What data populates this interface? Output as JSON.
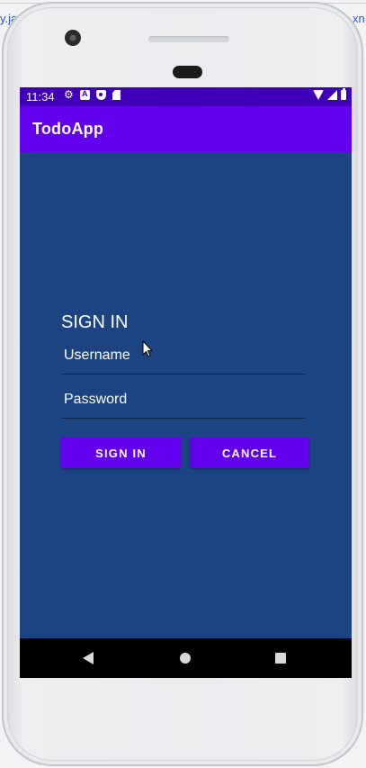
{
  "background_fragments": {
    "left_text": "y.ja",
    "right_text": "xn"
  },
  "status_bar": {
    "time": "11:34",
    "left_icons": [
      "gear-icon",
      "alert-icon",
      "shield-icon",
      "sd-card-icon"
    ],
    "right_icons": [
      "wifi-icon",
      "signal-icon",
      "battery-icon"
    ],
    "color": "#3f00b8"
  },
  "app_bar": {
    "title": "TodoApp",
    "color": "#6200ee"
  },
  "login": {
    "heading": "SIGN IN",
    "username_placeholder": "Username",
    "username_value": "",
    "password_placeholder": "Password",
    "password_value": "",
    "signin_label": "SIGN IN",
    "cancel_label": "CANCEL",
    "background": "#1c4483",
    "button_color": "#6200ee"
  },
  "nav_bar": {
    "icons": [
      "back-icon",
      "home-icon",
      "recents-icon"
    ]
  }
}
